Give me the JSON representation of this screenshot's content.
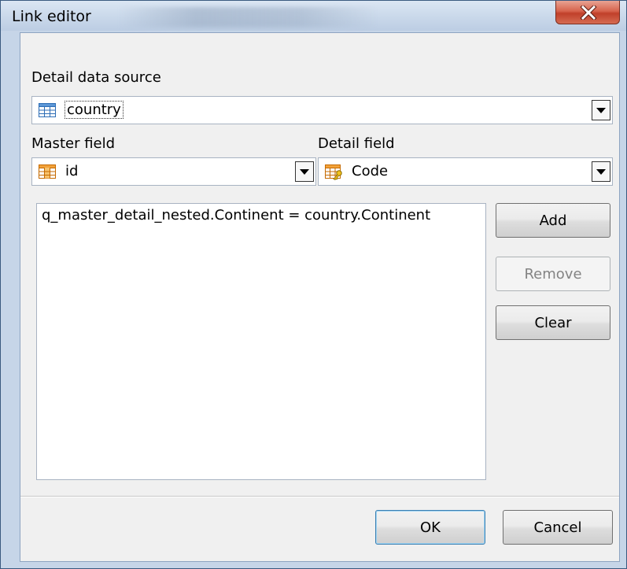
{
  "window": {
    "title": "Link editor",
    "close_icon": "close-icon"
  },
  "detail_source": {
    "label": "Detail data source",
    "value": "country",
    "icon": "table-icon"
  },
  "master_field": {
    "label": "Master field",
    "value": "id",
    "icon": "table-column-icon"
  },
  "detail_field": {
    "label": "Detail field",
    "value": "Code",
    "icon": "key-field-icon"
  },
  "links": {
    "items": [
      "q_master_detail_nested.Continent = country.Continent"
    ]
  },
  "buttons": {
    "add": "Add",
    "remove": "Remove",
    "clear": "Clear",
    "ok": "OK",
    "cancel": "Cancel"
  },
  "colors": {
    "titlebar": "#c9d8ea",
    "close_button": "#d7644d",
    "client": "#f0f0f0",
    "default_button_border": "#3c7fb1"
  }
}
